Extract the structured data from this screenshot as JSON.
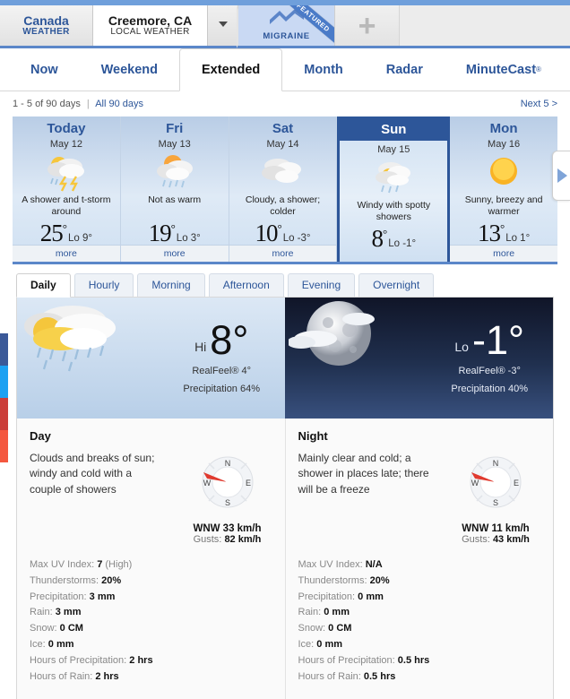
{
  "header": {
    "country_tab": {
      "title": "Canada",
      "subtitle": "WEATHER"
    },
    "location_tab": {
      "title": "Creemore, CA",
      "subtitle": "LOCAL WEATHER"
    },
    "caret_icon": "chevron-down-icon",
    "migraine_tab": {
      "label": "MIGRAINE",
      "ribbon": "FEATURED",
      "icon": "lightning-bolt-icon"
    },
    "add_tab": {
      "label": "+",
      "icon": "plus-icon"
    }
  },
  "nav": {
    "items": [
      {
        "label": "Now",
        "active": false
      },
      {
        "label": "Weekend",
        "active": false
      },
      {
        "label": "Extended",
        "active": true
      },
      {
        "label": "Month",
        "active": false
      },
      {
        "label": "Radar",
        "active": false
      },
      {
        "label": "MinuteCast",
        "sup": "®",
        "active": false
      }
    ]
  },
  "pager": {
    "range_text": "1 - 5 of 90 days",
    "separator": "|",
    "all_days_link": "All 90 days",
    "next_link": "Next 5 >"
  },
  "forecast_cards": [
    {
      "dayname": "Today",
      "date": "May 12",
      "icon": "thunderstorm-icon",
      "desc": "A shower and t-storm around",
      "hi": "25",
      "deg": "°",
      "lo": "Lo 9°",
      "more": "more",
      "selected": false
    },
    {
      "dayname": "Fri",
      "date": "May 13",
      "icon": "sun-rain-icon",
      "desc": "Not as warm",
      "hi": "19",
      "deg": "°",
      "lo": "Lo 3°",
      "more": "more",
      "selected": false
    },
    {
      "dayname": "Sat",
      "date": "May 14",
      "icon": "cloudy-icon",
      "desc": "Cloudy, a shower; colder",
      "hi": "10",
      "deg": "°",
      "lo": "Lo -3°",
      "more": "more",
      "selected": false
    },
    {
      "dayname": "Sun",
      "date": "May 15",
      "icon": "sun-shower-icon",
      "desc": "Windy with spotty showers",
      "hi": "8",
      "deg": "°",
      "lo": "Lo -1°",
      "more": "more",
      "selected": true
    },
    {
      "dayname": "Mon",
      "date": "May 16",
      "icon": "sunny-icon",
      "desc": "Sunny, breezy and warmer",
      "hi": "13",
      "deg": "°",
      "lo": "Lo 1°",
      "more": "more",
      "selected": false
    }
  ],
  "card_nav": {
    "next_arrow_icon": "chevron-right-icon"
  },
  "subtabs": [
    {
      "label": "Daily",
      "active": true
    },
    {
      "label": "Hourly",
      "active": false
    },
    {
      "label": "Morning",
      "active": false
    },
    {
      "label": "Afternoon",
      "active": false
    },
    {
      "label": "Evening",
      "active": false
    },
    {
      "label": "Overnight",
      "active": false
    }
  ],
  "day_panel": {
    "icon": "sun-shower-icon",
    "label": "Hi",
    "temp": "8°",
    "realfeel": "RealFeel® 4°",
    "precipitation": "Precipitation 64%",
    "heading": "Day",
    "narrative": "Clouds and breaks of sun; windy and cold with a couple of showers",
    "wind": {
      "compass_icon": "wind-compass-icon",
      "n": "N",
      "e": "E",
      "s": "S",
      "w": "W",
      "speed": "WNW 33 km/h",
      "gusts_label": "Gusts:",
      "gusts_value": "82 km/h",
      "needle_deg": 292
    },
    "stats": [
      {
        "label": "Max UV Index:",
        "value": "7",
        "note": "(High)"
      },
      {
        "label": "Thunderstorms:",
        "value": "20%",
        "note": ""
      },
      {
        "label": "Precipitation:",
        "value": "3 mm",
        "note": ""
      },
      {
        "label": "Rain:",
        "value": "3 mm",
        "note": ""
      },
      {
        "label": "Snow:",
        "value": "0 CM",
        "note": ""
      },
      {
        "label": "Ice:",
        "value": "0 mm",
        "note": ""
      },
      {
        "label": "Hours of Precipitation:",
        "value": "2 hrs",
        "note": ""
      },
      {
        "label": "Hours of Rain:",
        "value": "2 hrs",
        "note": ""
      }
    ]
  },
  "night_panel": {
    "icon": "moon-cloud-icon",
    "label": "Lo",
    "temp": "-1°",
    "realfeel": "RealFeel® -3°",
    "precipitation": "Precipitation 40%",
    "heading": "Night",
    "narrative": "Mainly clear and cold; a shower in places late; there will be a freeze",
    "wind": {
      "compass_icon": "wind-compass-icon",
      "n": "N",
      "e": "E",
      "s": "S",
      "w": "W",
      "speed": "WNW 11 km/h",
      "gusts_label": "Gusts:",
      "gusts_value": "43 km/h",
      "needle_deg": 292
    },
    "stats": [
      {
        "label": "Max UV Index:",
        "value": "N/A",
        "note": ""
      },
      {
        "label": "Thunderstorms:",
        "value": "20%",
        "note": ""
      },
      {
        "label": "Precipitation:",
        "value": "0 mm",
        "note": ""
      },
      {
        "label": "Rain:",
        "value": "0 mm",
        "note": ""
      },
      {
        "label": "Snow:",
        "value": "0 CM",
        "note": ""
      },
      {
        "label": "Ice:",
        "value": "0 mm",
        "note": ""
      },
      {
        "label": "Hours of Precipitation:",
        "value": "0.5 hrs",
        "note": ""
      },
      {
        "label": "Hours of Rain:",
        "value": "0.5 hrs",
        "note": ""
      }
    ]
  },
  "social_rail": [
    {
      "name": "facebook-share-button",
      "color": "#3b5998"
    },
    {
      "name": "twitter-share-button",
      "color": "#1da1f2"
    },
    {
      "name": "pinterest-share-button",
      "color": "#cb3e3a"
    },
    {
      "name": "google-share-button",
      "color": "#f4573f"
    }
  ],
  "colors": {
    "brand_blue": "#2d5699",
    "band_blue": "#5b87c9"
  }
}
